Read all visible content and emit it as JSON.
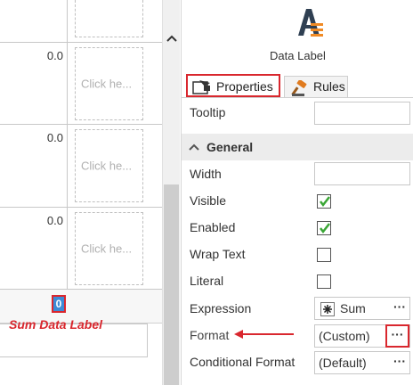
{
  "canvas": {
    "rows": [
      {
        "value": "",
        "placeholder": ""
      },
      {
        "value": "0.0",
        "placeholder": "Click he..."
      },
      {
        "value": "0.0",
        "placeholder": "Click he..."
      },
      {
        "value": "0.0",
        "placeholder": "Click he..."
      }
    ],
    "sum_value": "0",
    "sum_caption": "Sum Data Label"
  },
  "panel": {
    "title": "Data Label",
    "tabs": [
      {
        "label": "Properties",
        "icon": "properties-icon",
        "active": true
      },
      {
        "label": "Rules",
        "icon": "gavel-icon",
        "active": false
      }
    ],
    "tooltip_label": "Tooltip",
    "tooltip_value": "",
    "section_general": "General",
    "width_label": "Width",
    "width_value": "",
    "visible_label": "Visible",
    "visible_checked": true,
    "enabled_label": "Enabled",
    "enabled_checked": true,
    "wrap_text_label": "Wrap Text",
    "wrap_text_checked": false,
    "literal_label": "Literal",
    "literal_checked": false,
    "expression_label": "Expression",
    "expression_value": "Sum",
    "format_label": "Format",
    "format_value": "(Custom)",
    "conditional_format_label": "Conditional Format",
    "conditional_format_value": "(Default)",
    "ellipsis": "···"
  },
  "colors": {
    "highlight_red": "#d9272e",
    "selection_blue": "#3d8bd6",
    "check_green": "#3aa635",
    "logo_dark": "#2f3f52",
    "logo_orange": "#f08a24"
  }
}
